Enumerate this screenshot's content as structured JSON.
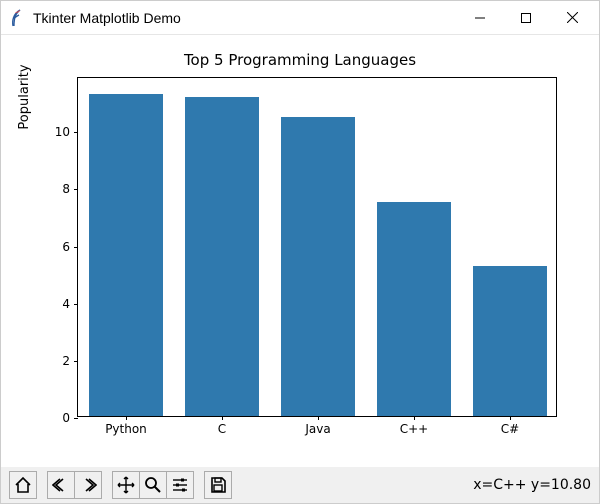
{
  "window": {
    "title": "Tkinter Matplotlib Demo"
  },
  "chart_data": {
    "type": "bar",
    "title": "Top 5 Programming Languages",
    "xlabel": "",
    "ylabel": "Popularity",
    "categories": [
      "Python",
      "C",
      "Java",
      "C++",
      "C#"
    ],
    "values": [
      11.27,
      11.16,
      10.46,
      7.5,
      5.26
    ],
    "ylim": [
      0,
      11.9
    ],
    "yticks": [
      0,
      2,
      4,
      6,
      8,
      10
    ]
  },
  "toolbar": {
    "home": "Home",
    "back": "Back",
    "forward": "Forward",
    "pan": "Pan",
    "zoom": "Zoom",
    "configure": "Configure subplots",
    "save": "Save",
    "coord": "x=C++ y=10.80"
  }
}
